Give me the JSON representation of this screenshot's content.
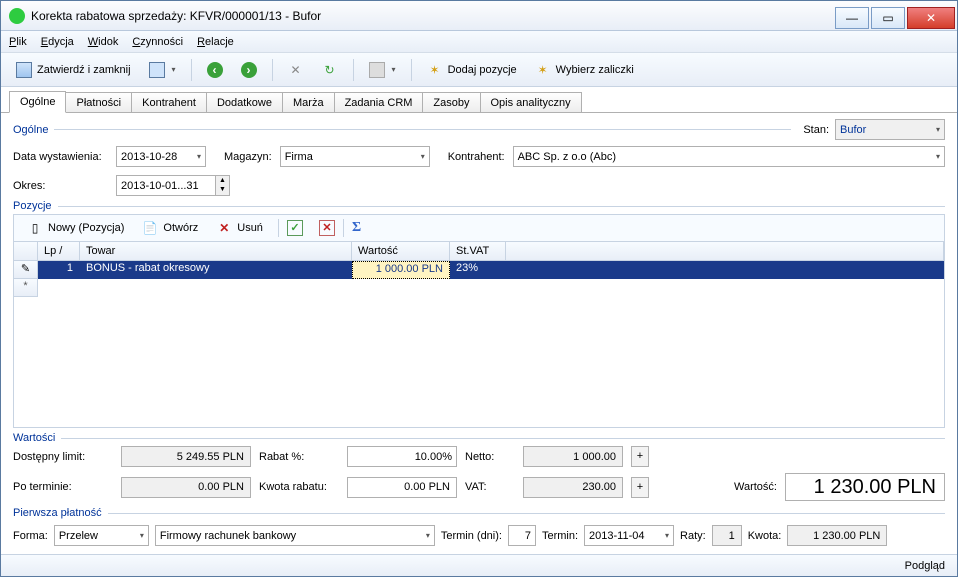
{
  "window": {
    "title": "Korekta rabatowa sprzedaży: KFVR/000001/13 - Bufor"
  },
  "menu": {
    "plik": "Plik",
    "edycja": "Edycja",
    "widok": "Widok",
    "czynnosci": "Czynności",
    "relacje": "Relacje"
  },
  "toolbar": {
    "zatwierdz": "Zatwierdź i zamknij",
    "dodaj_pozycje": "Dodaj pozycje",
    "wybierz_zaliczki": "Wybierz zaliczki"
  },
  "tabs": {
    "ogolne": "Ogólne",
    "platnosci": "Płatności",
    "kontrahent": "Kontrahent",
    "dodatkowe": "Dodatkowe",
    "marza": "Marża",
    "zadania": "Zadania CRM",
    "zasoby": "Zasoby",
    "opis": "Opis analityczny"
  },
  "sections": {
    "ogolne": "Ogólne",
    "okres": "Okres",
    "pozycje": "Pozycje",
    "wartosci": "Wartości",
    "pierwsza": "Pierwsza płatność"
  },
  "fields": {
    "stan_label": "Stan:",
    "stan": "Bufor",
    "data_label": "Data wystawienia:",
    "data": "2013-10-28",
    "magazyn_label": "Magazyn:",
    "magazyn": "Firma",
    "kontrahent_label": "Kontrahent:",
    "kontrahent": "ABC Sp. z o.o (Abc)",
    "okres_label": "Okres:",
    "okres": "2013-10-01...31"
  },
  "poz_toolbar": {
    "nowy": "Nowy (Pozycja)",
    "otworz": "Otwórz",
    "usun": "Usuń"
  },
  "grid": {
    "headers": {
      "lp": "Lp /",
      "towar": "Towar",
      "wartosc": "Wartość",
      "stvat": "St.VAT"
    },
    "row1": {
      "lp": "1",
      "towar": "BONUS - rabat okresowy",
      "wartosc": "1 000.00 PLN",
      "vat": "23%"
    },
    "edit_marker": "✎",
    "new_marker": "*"
  },
  "values": {
    "dostepny_label": "Dostępny limit:",
    "dostepny": "5 249.55 PLN",
    "rabat_pct_label": "Rabat %:",
    "rabat_pct": "10.00%",
    "netto_label": "Netto:",
    "netto": "1 000.00",
    "po_terminie_label": "Po terminie:",
    "po_terminie": "0.00 PLN",
    "kwota_rabatu_label": "Kwota rabatu:",
    "kwota_rabatu": "0.00 PLN",
    "vat_label": "VAT:",
    "vat": "230.00",
    "wartosc_label": "Wartość:",
    "wartosc": "1 230.00 PLN",
    "plus": "+"
  },
  "payment": {
    "forma_label": "Forma:",
    "forma": "Przelew",
    "rachunek": "Firmowy rachunek bankowy",
    "termin_dni_label": "Termin (dni):",
    "termin_dni": "7",
    "termin_label": "Termin:",
    "termin": "2013-11-04",
    "raty_label": "Raty:",
    "raty": "1",
    "kwota_label": "Kwota:",
    "kwota": "1 230.00 PLN"
  },
  "status": {
    "podglad": "Podgląd"
  }
}
